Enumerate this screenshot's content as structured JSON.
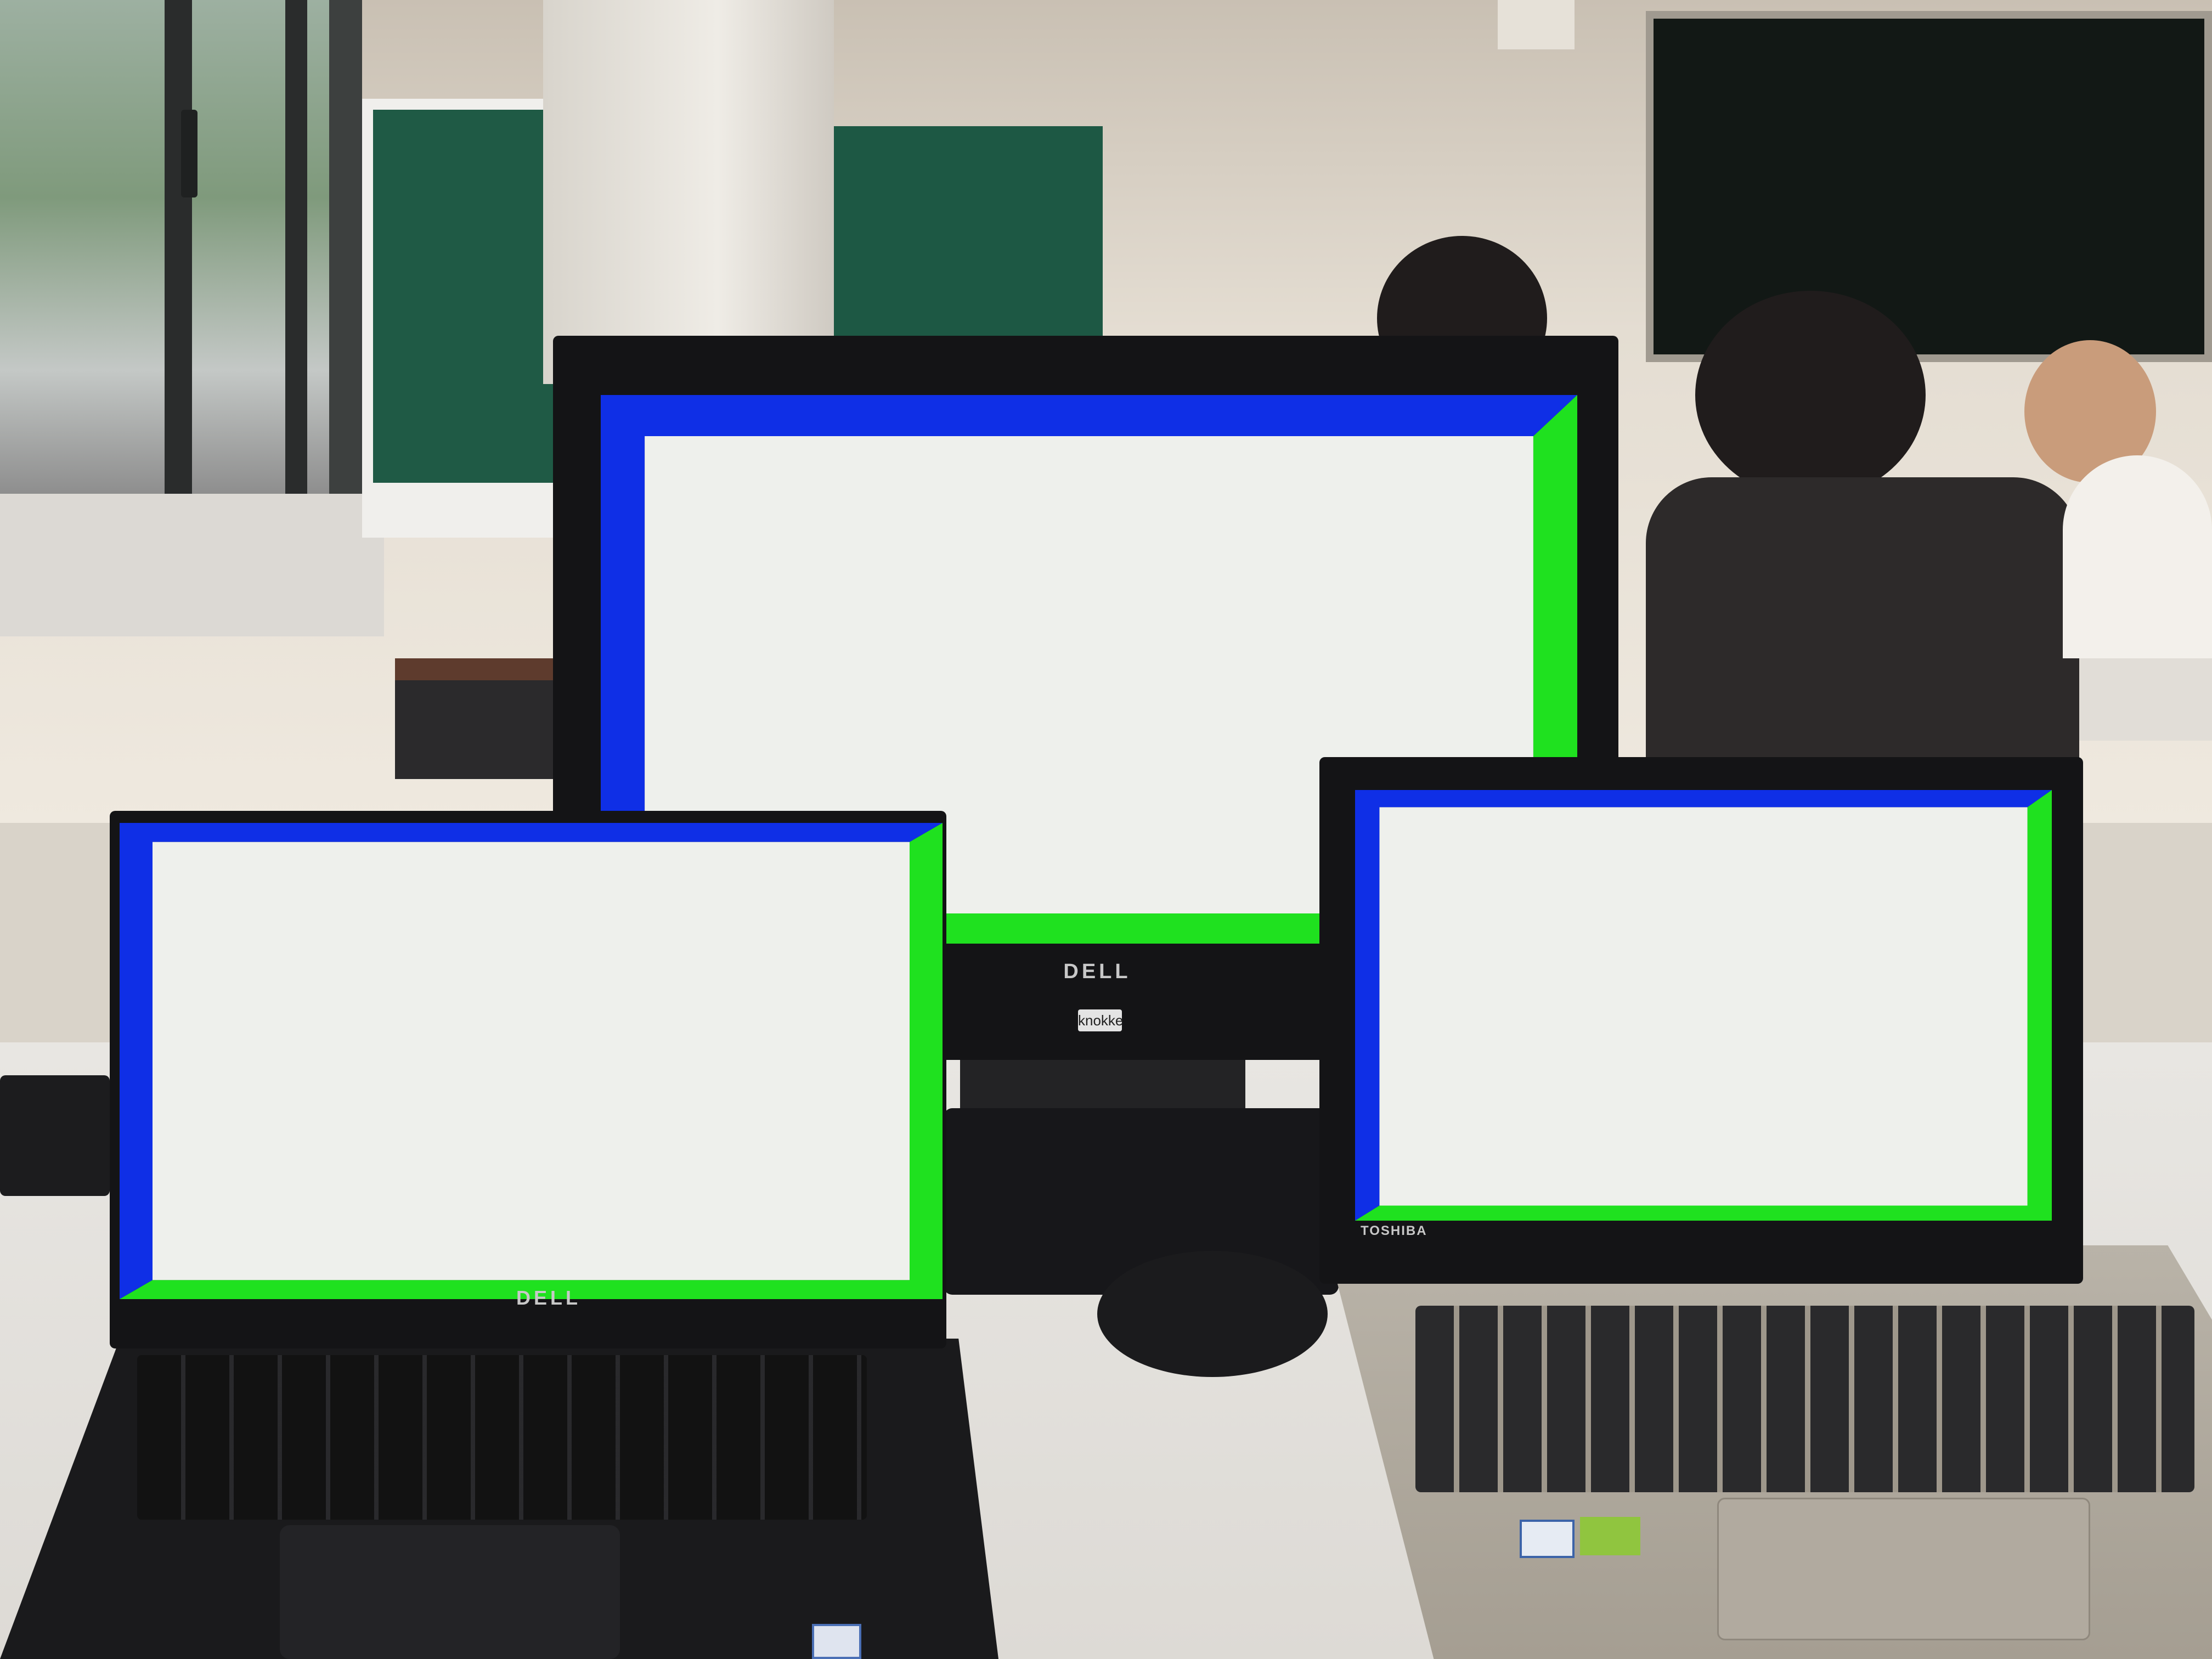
{
  "scene": {
    "screen_colors": {
      "top_left_border": "#0f2fe6",
      "bottom_right_border": "#1fe11f",
      "interior": "#eef0ec"
    }
  },
  "monitor": {
    "brand": "DELL",
    "tag": "knokke"
  },
  "laptop_left": {
    "brand": "DELL"
  },
  "laptop_right": {
    "brand": "TOSHIBA"
  }
}
